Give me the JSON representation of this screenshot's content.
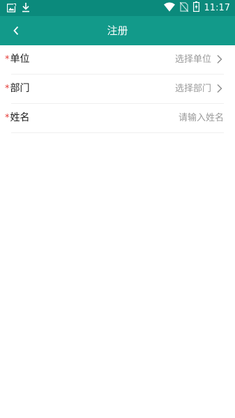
{
  "status_bar": {
    "time": "11:17",
    "icons": [
      "image-notification-icon",
      "download-icon",
      "wifi-icon",
      "no-sim-icon",
      "battery-charging-icon"
    ]
  },
  "app_bar": {
    "title": "注册",
    "back_icon": "chevron-left-icon"
  },
  "form": {
    "required_mark": "*",
    "rows": [
      {
        "label": "单位",
        "value": "选择单位",
        "icon": "chevron-right-icon"
      },
      {
        "label": "部门",
        "value": "选择部门",
        "icon": "chevron-right-icon"
      },
      {
        "label": "姓名",
        "placeholder": "请输入姓名"
      }
    ]
  },
  "colors": {
    "status_bar": "#0b8a7c",
    "app_bar": "#129a8a",
    "required": "#e53935",
    "hint": "#9a9a9a"
  }
}
